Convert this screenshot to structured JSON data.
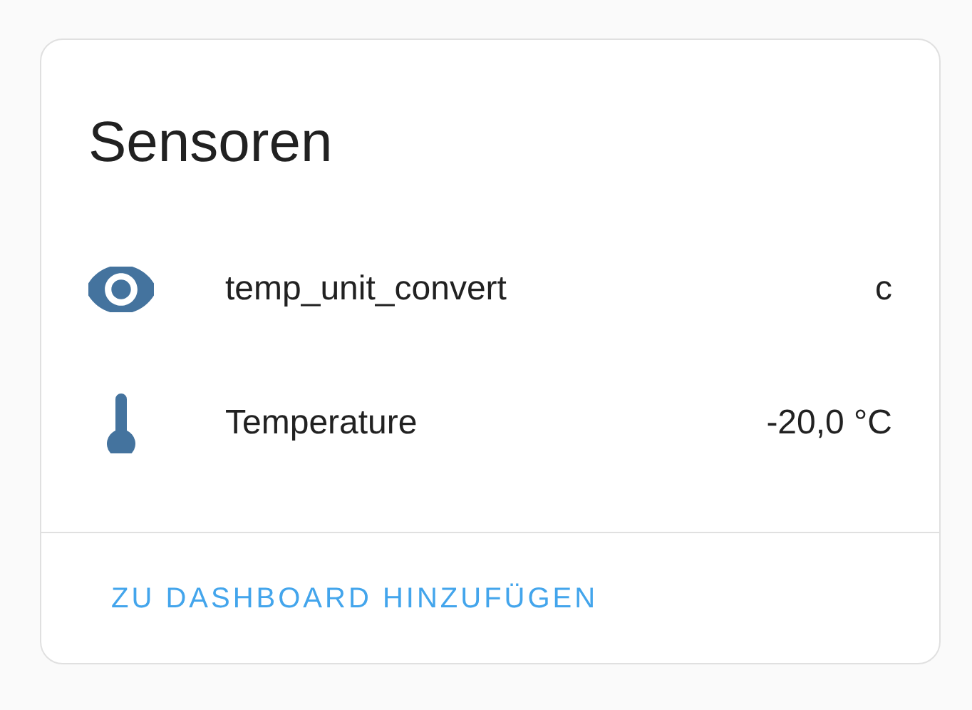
{
  "card": {
    "title": "Sensoren",
    "entities": [
      {
        "name": "temp_unit_convert",
        "state": "c"
      },
      {
        "name": "Temperature",
        "state": "-20,0 °C"
      }
    ],
    "action": "ZU DASHBOARD HINZUFÜGEN"
  }
}
